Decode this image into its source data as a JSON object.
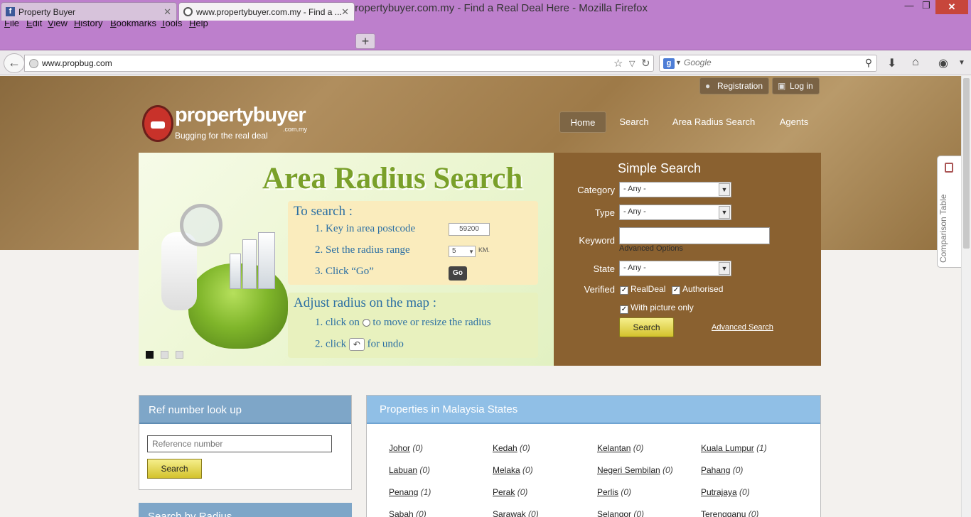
{
  "window": {
    "title": "www.propertybuyer.com.my - Find a Real Deal Here - Mozilla Firefox"
  },
  "menu": [
    "File",
    "Edit",
    "View",
    "History",
    "Bookmarks",
    "Tools",
    "Help"
  ],
  "tabs": [
    {
      "label": "Property Buyer"
    },
    {
      "label": "www.propertybuyer.com.my - Find a ..."
    }
  ],
  "navbar": {
    "url": "www.propbug.com",
    "search_placeholder": "Google"
  },
  "site": {
    "top_buttons": {
      "registration": "Registration",
      "login": "Log in"
    },
    "logo": {
      "name": "propertybuyer",
      "tld": ".com.my",
      "tagline": "Bugging for the real deal"
    },
    "nav": [
      "Home",
      "Search",
      "Area Radius Search",
      "Agents"
    ],
    "slider": {
      "heading": "Area Radius Search",
      "panel1_title": "To search :",
      "steps": [
        "1. Key in area postcode",
        "2. Set the radius range",
        "3. Click “Go”"
      ],
      "postcode_example": "59200",
      "radius_value": "5",
      "radius_unit": "KM.",
      "go_label": "Go",
      "panel2_title": "Adjust radius on the map :",
      "adjust_step1_a": "1. click on",
      "adjust_step1_b": "to move or resize the radius",
      "adjust_step2_a": "2. click",
      "adjust_step2_b": "for undo"
    },
    "simple_search": {
      "title": "Simple Search",
      "category_label": "Category",
      "category_value": "- Any -",
      "type_label": "Type",
      "type_value": "- Any -",
      "keyword_label": "Keyword",
      "advanced_options": "Advanced Options",
      "state_label": "State",
      "state_value": "- Any -",
      "verified_label": "Verified",
      "realdeal": "RealDeal",
      "authorised": "Authorised",
      "with_picture": "With picture only",
      "search_button": "Search",
      "advanced_search": "Advanced Search"
    },
    "comparison_tab": "Comparison Table",
    "ref_lookup": {
      "title": "Ref number look up",
      "placeholder": "Reference number",
      "button": "Search"
    },
    "radius_box": {
      "title": "Search by Radius"
    },
    "states_box": {
      "title": "Properties in Malaysia States",
      "states": [
        {
          "name": "Johor",
          "count": "(0)"
        },
        {
          "name": "Kedah",
          "count": "(0)"
        },
        {
          "name": "Kelantan",
          "count": "(0)"
        },
        {
          "name": "Kuala Lumpur",
          "count": "(1)"
        },
        {
          "name": "Labuan",
          "count": "(0)"
        },
        {
          "name": "Melaka",
          "count": "(0)"
        },
        {
          "name": "Negeri Sembilan",
          "count": "(0)"
        },
        {
          "name": "Pahang",
          "count": "(0)"
        },
        {
          "name": "Penang",
          "count": "(1)"
        },
        {
          "name": "Perak",
          "count": "(0)"
        },
        {
          "name": "Perlis",
          "count": "(0)"
        },
        {
          "name": "Putrajaya",
          "count": "(0)"
        },
        {
          "name": "Sabah",
          "count": "(0)"
        },
        {
          "name": "Sarawak",
          "count": "(0)"
        },
        {
          "name": "Selangor",
          "count": "(0)"
        },
        {
          "name": "Terengganu",
          "count": "(0)"
        }
      ]
    }
  },
  "colors": {
    "titlebar": "#bd7fcc",
    "search_panel": "#8a6130",
    "box_header": "#7ea6c8",
    "button_yellow": "#e6d85a"
  }
}
